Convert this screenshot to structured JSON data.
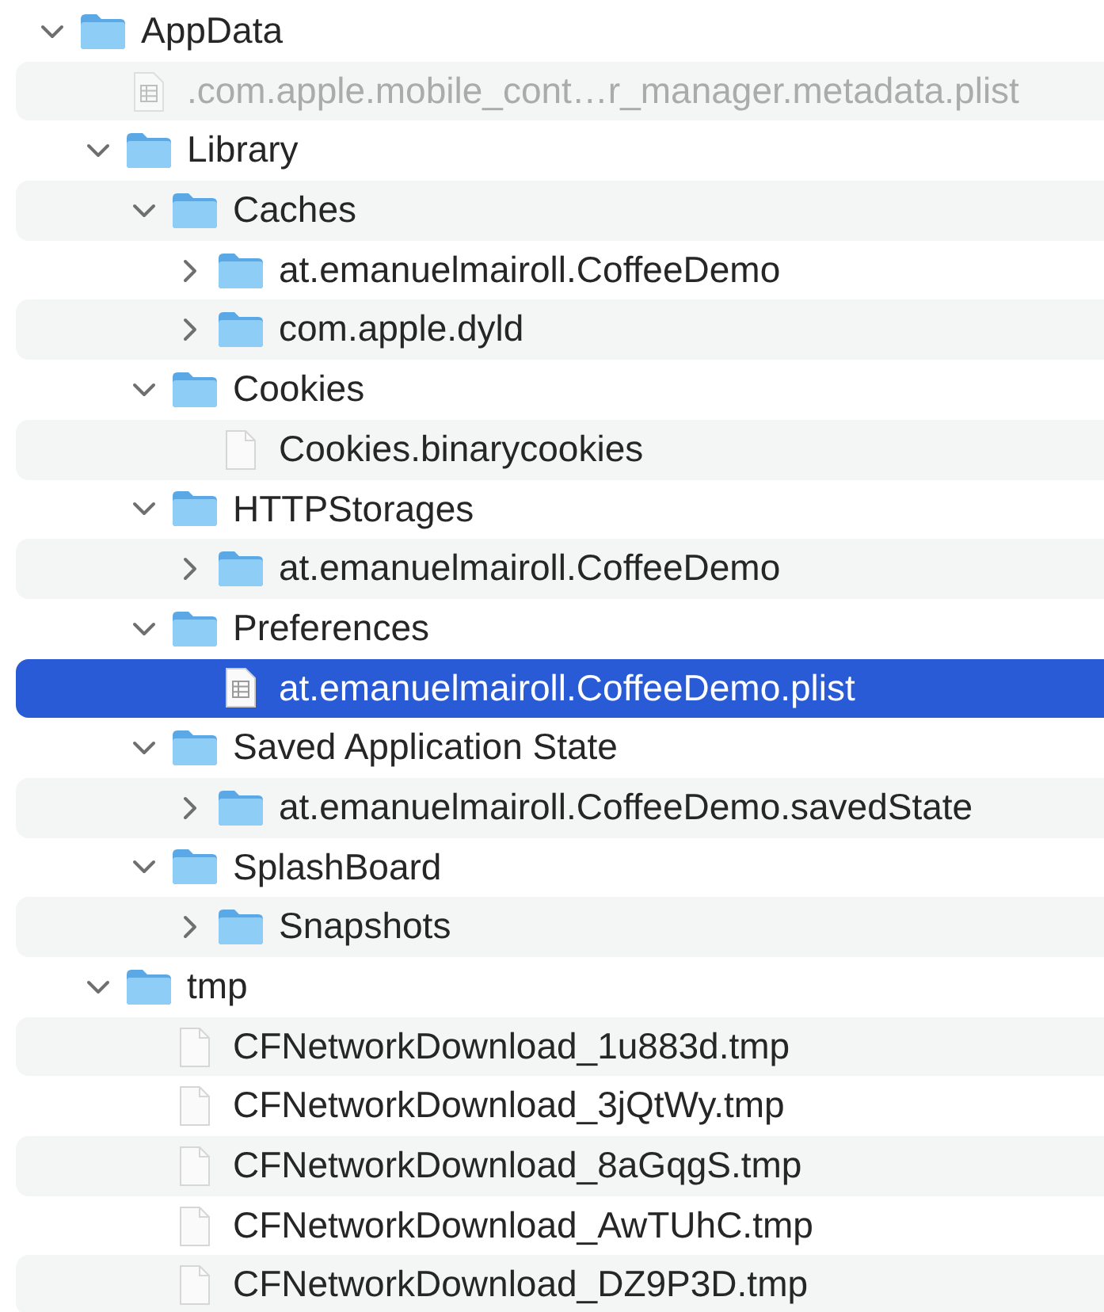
{
  "tree": [
    {
      "kind": "folder",
      "name": "AppData",
      "expanded": true,
      "selected": false,
      "children": [
        {
          "kind": "plist",
          "name": ".com.apple.mobile_cont…r_manager.metadata.plist",
          "dimmed": true,
          "selected": false
        },
        {
          "kind": "folder",
          "name": "Library",
          "expanded": true,
          "selected": false,
          "children": [
            {
              "kind": "folder",
              "name": "Caches",
              "expanded": true,
              "selected": false,
              "children": [
                {
                  "kind": "folder",
                  "name": "at.emanuelmairoll.CoffeeDemo",
                  "expanded": false,
                  "selected": false
                },
                {
                  "kind": "folder",
                  "name": "com.apple.dyld",
                  "expanded": false,
                  "selected": false
                }
              ]
            },
            {
              "kind": "folder",
              "name": "Cookies",
              "expanded": true,
              "selected": false,
              "children": [
                {
                  "kind": "file",
                  "name": "Cookies.binarycookies",
                  "selected": false
                }
              ]
            },
            {
              "kind": "folder",
              "name": "HTTPStorages",
              "expanded": true,
              "selected": false,
              "children": [
                {
                  "kind": "folder",
                  "name": "at.emanuelmairoll.CoffeeDemo",
                  "expanded": false,
                  "selected": false
                }
              ]
            },
            {
              "kind": "folder",
              "name": "Preferences",
              "expanded": true,
              "selected": false,
              "children": [
                {
                  "kind": "plist",
                  "name": "at.emanuelmairoll.CoffeeDemo.plist",
                  "selected": true
                }
              ]
            },
            {
              "kind": "folder",
              "name": "Saved Application State",
              "expanded": true,
              "selected": false,
              "children": [
                {
                  "kind": "folder",
                  "name": "at.emanuelmairoll.CoffeeDemo.savedState",
                  "expanded": false,
                  "selected": false
                }
              ]
            },
            {
              "kind": "folder",
              "name": "SplashBoard",
              "expanded": true,
              "selected": false,
              "children": [
                {
                  "kind": "folder",
                  "name": "Snapshots",
                  "expanded": false,
                  "selected": false
                }
              ]
            }
          ]
        },
        {
          "kind": "folder",
          "name": "tmp",
          "expanded": true,
          "selected": false,
          "children": [
            {
              "kind": "file",
              "name": "CFNetworkDownload_1u883d.tmp",
              "selected": false
            },
            {
              "kind": "file",
              "name": "CFNetworkDownload_3jQtWy.tmp",
              "selected": false
            },
            {
              "kind": "file",
              "name": "CFNetworkDownload_8aGqgS.tmp",
              "selected": false
            },
            {
              "kind": "file",
              "name": "CFNetworkDownload_AwTUhC.tmp",
              "selected": false
            },
            {
              "kind": "file",
              "name": "CFNetworkDownload_DZ9P3D.tmp",
              "selected": false
            }
          ]
        }
      ]
    }
  ]
}
